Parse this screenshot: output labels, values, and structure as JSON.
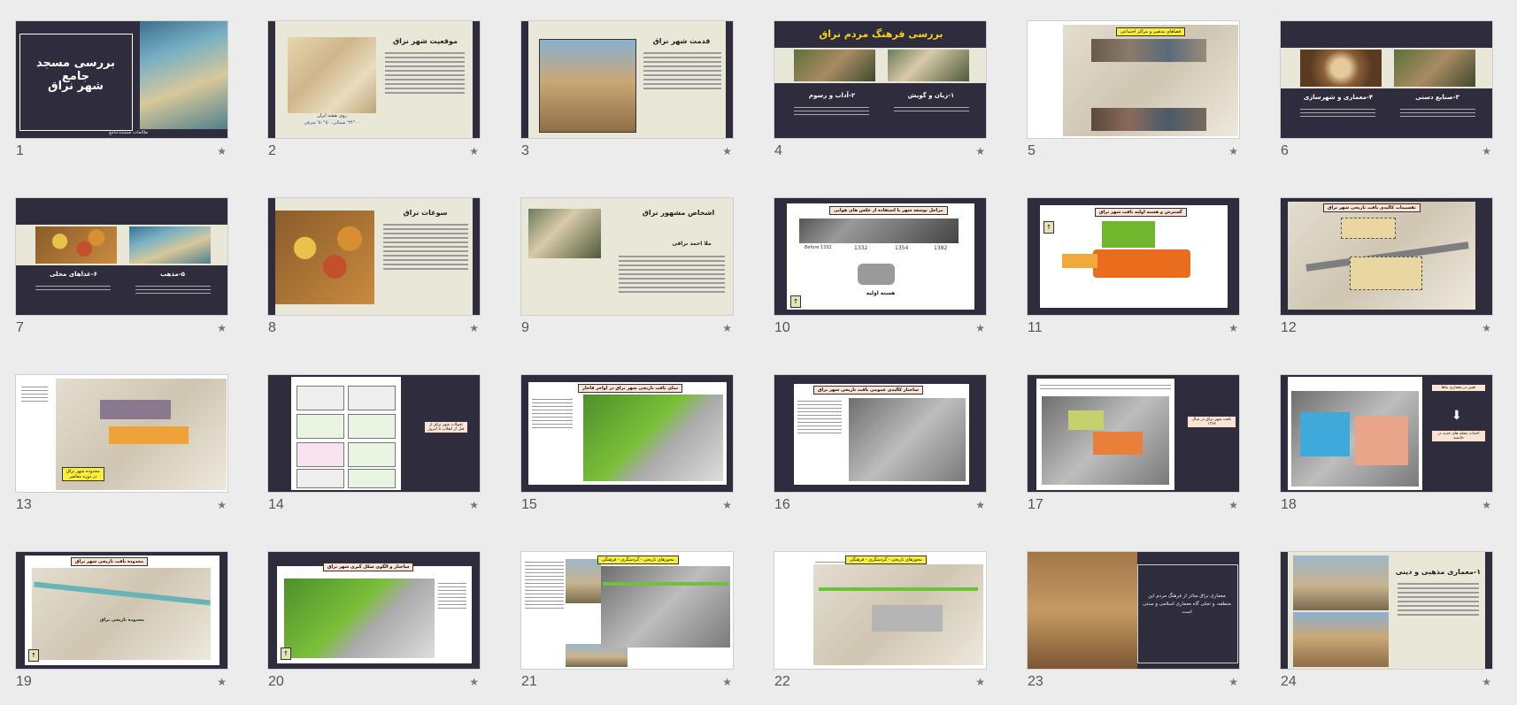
{
  "star": "★",
  "slides": [
    {
      "n": "1",
      "texts": {
        "title": "بررسی مسجد جامع",
        "sub": "شهر نراق",
        "footer": "طالعات مسجدجامع"
      }
    },
    {
      "n": "2",
      "texts": {
        "title": "موقعیت شهر نراق",
        "cap1": "روی نقشه ایران",
        "cap2": "۳۴°۰۰' شمالی، ۵۰°۵۰' شرقی"
      }
    },
    {
      "n": "3",
      "texts": {
        "title": "قدمت شهر نراق"
      }
    },
    {
      "n": "4",
      "texts": {
        "title": "بررسی فرهنگ مردم نراق",
        "h1": "۱-زبان و گویش",
        "h2": "۲-آداب و رسوم"
      }
    },
    {
      "n": "5",
      "texts": {
        "label": "فضاهای مذهبی و مراکز اجتماعی"
      }
    },
    {
      "n": "6",
      "texts": {
        "h1": "۳-صنایع دستی",
        "h2": "۴-معماری و شهرسازی"
      }
    },
    {
      "n": "7",
      "texts": {
        "h1": "۵-مذهب",
        "h2": "۶-غذاهای محلی"
      }
    },
    {
      "n": "8",
      "texts": {
        "title": "سوغات نراق"
      }
    },
    {
      "n": "9",
      "texts": {
        "title": "اشخاص مشهور نراق",
        "sub": "ملا احمد نراقی"
      }
    },
    {
      "n": "10",
      "texts": {
        "label": "مراحل توسعه شهر با استفاده از عکس های هوایی",
        "y0": "Before 1332",
        "y1": "1332",
        "y2": "1354",
        "y3": "1382",
        "core": "هسته اولیه"
      }
    },
    {
      "n": "11",
      "texts": {
        "label": "گسترش و هسته اولیه بافت شهر نراق"
      }
    },
    {
      "n": "12",
      "texts": {
        "label": "تقسیمات کالبدی بافت تاریخی شهر نراق"
      }
    },
    {
      "n": "13",
      "texts": {
        "label": "محدوده شهر نراق",
        "sub": "در دوره معاصر"
      }
    },
    {
      "n": "14",
      "texts": {
        "note": "تحولات شهر نراق از قبل از انقلاب تا امروز"
      }
    },
    {
      "n": "15",
      "texts": {
        "label": "نمای بافت تاریخی شهر نراق در اواخر قاجار"
      }
    },
    {
      "n": "16",
      "texts": {
        "label": "ساختار کالبدی عمومی بافت تاریخی شهر نراق"
      }
    },
    {
      "n": "17",
      "texts": {
        "note": "بافت شهر نراق در سال ۱۳۶۷"
      }
    },
    {
      "n": "18",
      "texts": {
        "note1": "تغییر در معماری بناها",
        "note2": "احداث محله های جدید در حاشیه"
      }
    },
    {
      "n": "19",
      "texts": {
        "label": "محدوده بافت تاریخی شهر نراق",
        "inner": "محدوده تاریخی نراق"
      }
    },
    {
      "n": "20",
      "texts": {
        "label": "ساختار و الگوی شکل گیری شهر نراق"
      }
    },
    {
      "n": "21",
      "texts": {
        "label": "محورهای تاریخی - گردشگری - فرهنگی"
      }
    },
    {
      "n": "22",
      "texts": {
        "label": "محورهای تاریخی - گردشگری - فرهنگی"
      }
    },
    {
      "n": "23",
      "texts": {
        "body": "معماری نراق متاثر از فرهنگ مردم این منطقه، و تجلی گاه معماری اسلامی و سنتی است"
      }
    },
    {
      "n": "24",
      "texts": {
        "title": "۱-معماری مذهبی و دینی"
      }
    }
  ]
}
